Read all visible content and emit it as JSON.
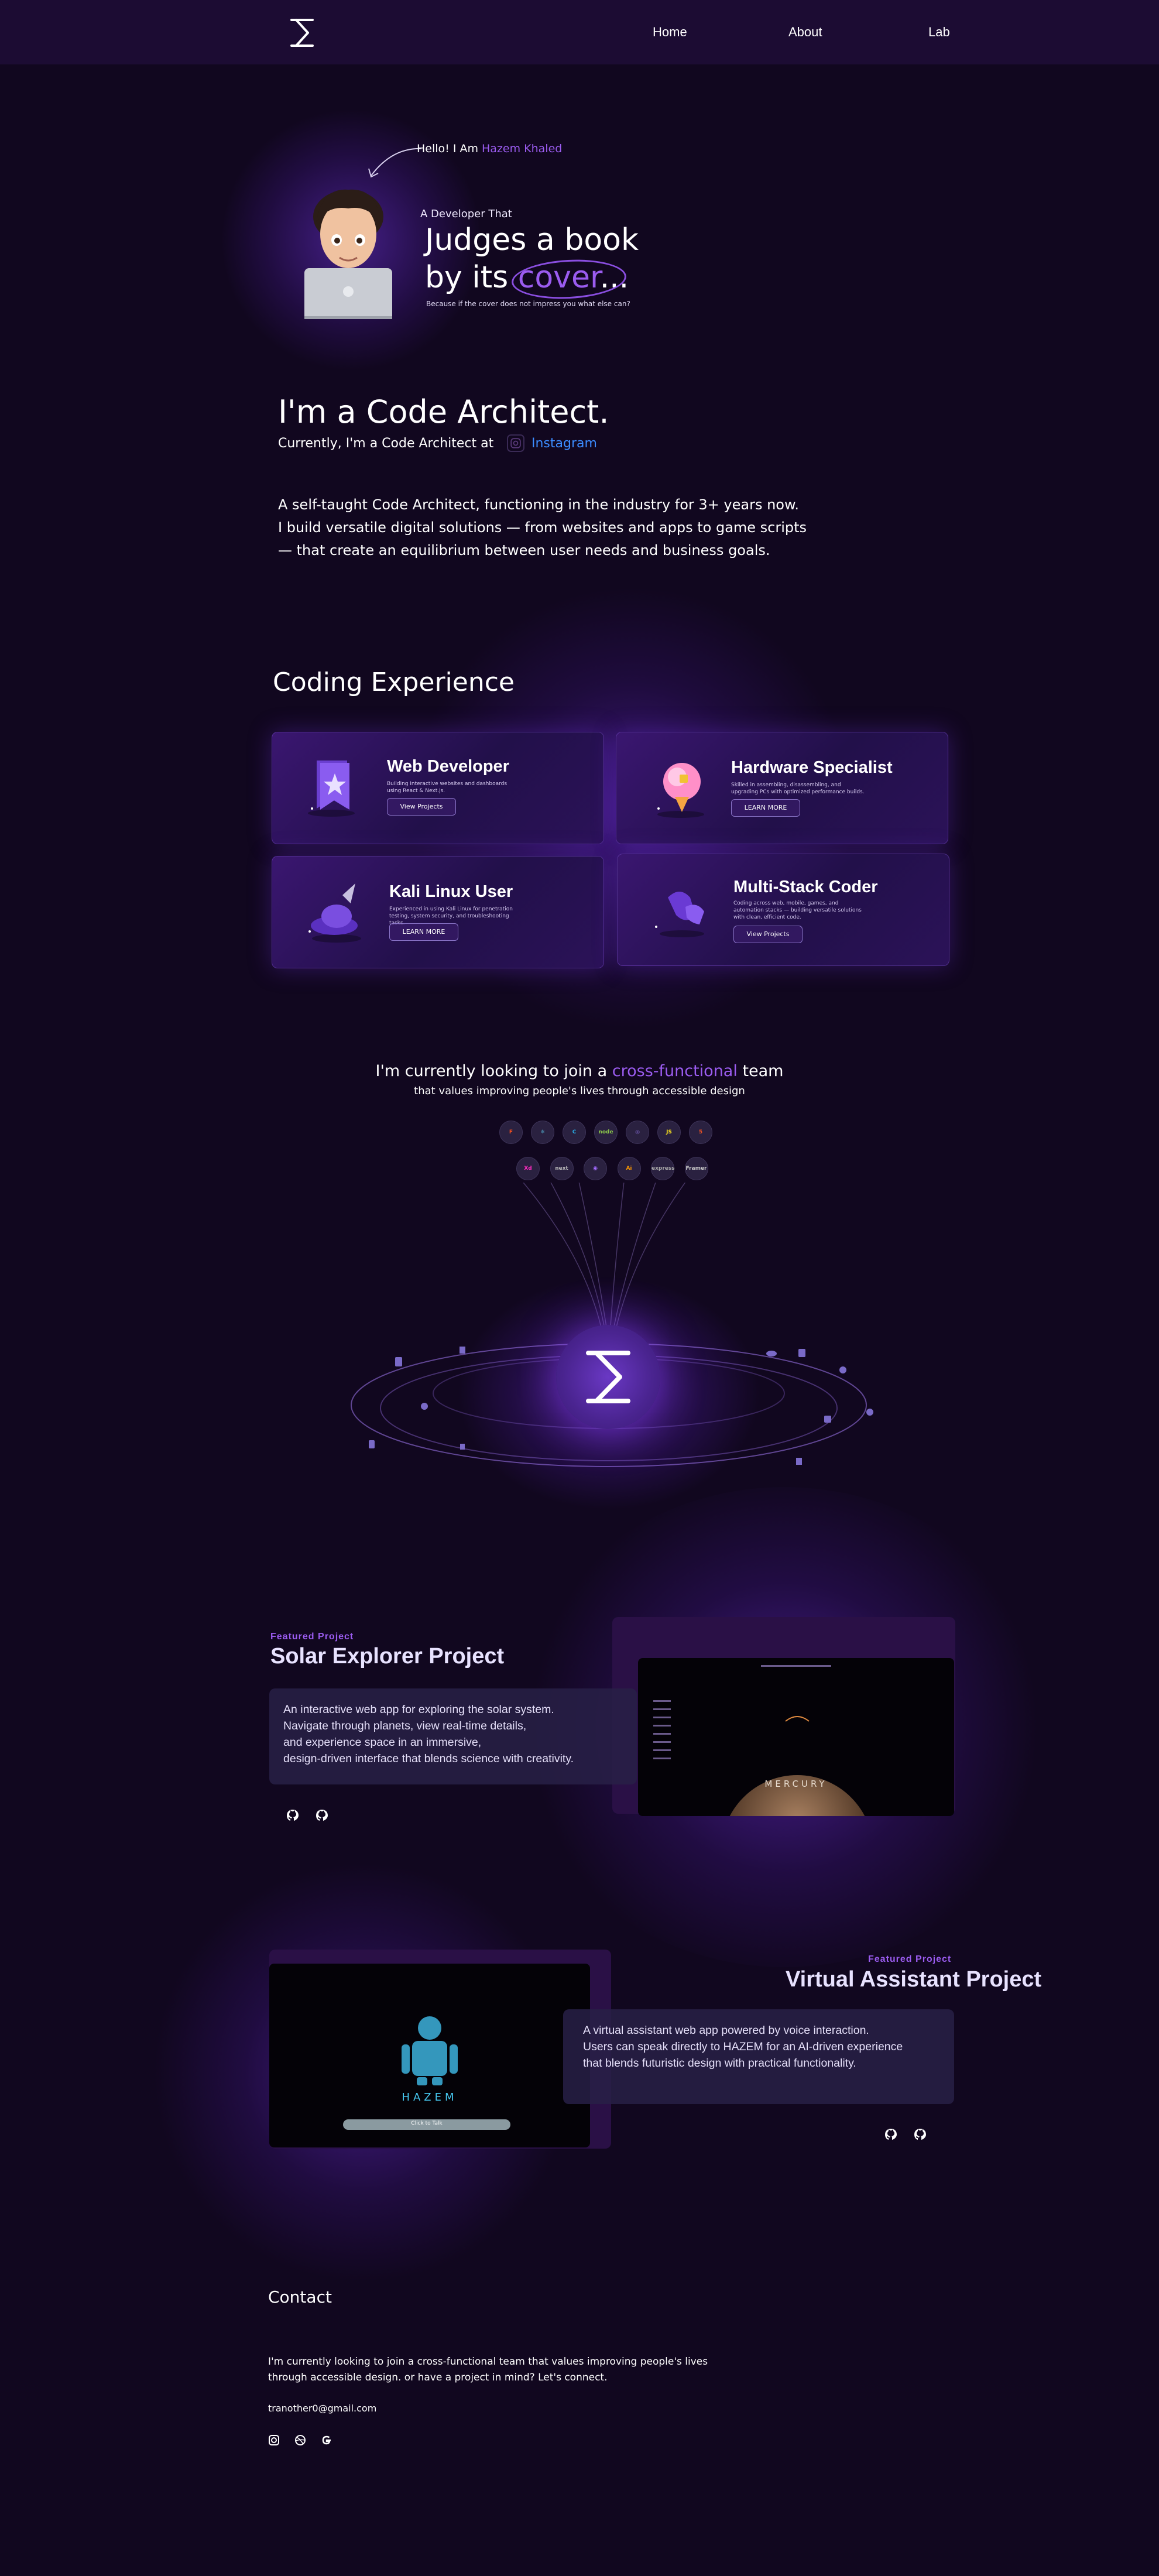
{
  "nav": {
    "links": [
      "Home",
      "About",
      "Lab"
    ]
  },
  "hero": {
    "greeting_prefix": "Hello! I Am",
    "greeting_name": "Hazem Khaled",
    "dev_that": "A Developer That",
    "headline_line1": "Judges a book",
    "headline_line2_prefix": "by its ",
    "headline_highlight": "cover",
    "headline_suffix": "...",
    "subnote": "Because if the cover does not impress you what else can?"
  },
  "intro": {
    "title": "I'm a Code Architect.",
    "currently": "Currently, I'm a Code Architect at",
    "company": "Instagram",
    "bio_lines": [
      "A self-taught Code Architect, functioning in the industry for 3+ years now.",
      "I build versatile digital solutions — from websites and apps to game scripts",
      "— that create an equilibrium between user needs and business goals."
    ]
  },
  "experience": {
    "title": "Coding Experience",
    "cards": [
      {
        "title": "Web Developer",
        "desc": "Building interactive websites and dashboards using React & Next.js.",
        "button": "View Projects",
        "icon": "star-badge-icon"
      },
      {
        "title": "Hardware Specialist",
        "desc": "Skilled in assembling, disassembling, and upgrading PCs with optimized performance builds.",
        "button": "LEARN MORE",
        "icon": "ice-cream-chip-icon"
      },
      {
        "title": "Kali Linux User",
        "desc": "Experienced in using Kali Linux for penetration testing, system security, and troubleshooting tasks.",
        "button": "LEARN MORE",
        "icon": "helmet-terminal-icon"
      },
      {
        "title": "Multi-Stack Coder",
        "desc": "Coding across web, mobile, games, and automation stacks — building versatile solutions with clean, efficient code.",
        "button": "View Projects",
        "icon": "controller-icon"
      }
    ]
  },
  "looking": {
    "prefix": "I'm currently looking to join a ",
    "highlight": "cross-functional",
    "suffix": " team",
    "sub": "that values improving people's lives through accessible design"
  },
  "tech_row1": [
    {
      "label": "F",
      "name": "figma-icon",
      "color": "#f24e1e"
    },
    {
      "label": "⚛",
      "name": "react-icon",
      "color": "#61dafb"
    },
    {
      "label": "C",
      "name": "css-icon",
      "color": "#29a8e0"
    },
    {
      "label": "node",
      "name": "nodejs-icon",
      "color": "#8cc84b"
    },
    {
      "label": "◎",
      "name": "redux-icon",
      "color": "#7a62c4"
    },
    {
      "label": "JS",
      "name": "javascript-icon",
      "color": "#f7df1e"
    },
    {
      "label": "5",
      "name": "html-icon",
      "color": "#e34f26"
    }
  ],
  "tech_row2": [
    {
      "label": "Xd",
      "name": "adobe-xd-icon",
      "color": "#ff2bc2"
    },
    {
      "label": "next",
      "name": "nextjs-icon",
      "color": "#bbbbbb"
    },
    {
      "label": "◉",
      "name": "vite-icon",
      "color": "#a26bff"
    },
    {
      "label": "Ai",
      "name": "illustrator-icon",
      "color": "#ff9a00"
    },
    {
      "label": "express",
      "name": "express-icon",
      "color": "#aaaaaa"
    },
    {
      "label": "Framer",
      "name": "framer-icon",
      "color": "#cccccc"
    }
  ],
  "projects": [
    {
      "eyebrow": "Featured  Project",
      "title": "Solar Explorer Project",
      "desc_lines": [
        "An interactive web app for exploring the solar system.",
        "Navigate through planets, view real-time details,",
        "and experience space in an immersive,",
        "design-driven interface that blends science with creativity."
      ],
      "screen_label": "MERCURY"
    },
    {
      "eyebrow": "Featured  Project",
      "title": "Virtual Assistant Project",
      "desc_lines": [
        "A virtual assistant web app powered by voice interaction.",
        "Users can speak directly to HAZEM for an AI-driven experience",
        "that blends futuristic design with practical functionality."
      ],
      "screen_label": "HAZEM",
      "screen_button": "Click to Talk"
    }
  ],
  "contact": {
    "title": "Contact",
    "text_line1": "I'm currently looking to join a cross-functional team that values improving people's lives",
    "text_line2": "through accessible design. or have a project in mind? Let's connect.",
    "email": "tranother0@gmail.com"
  },
  "colors": {
    "background": "#11071f",
    "nav": "#1c0c33",
    "accent": "#9b5cf0",
    "link": "#3c8cff"
  }
}
